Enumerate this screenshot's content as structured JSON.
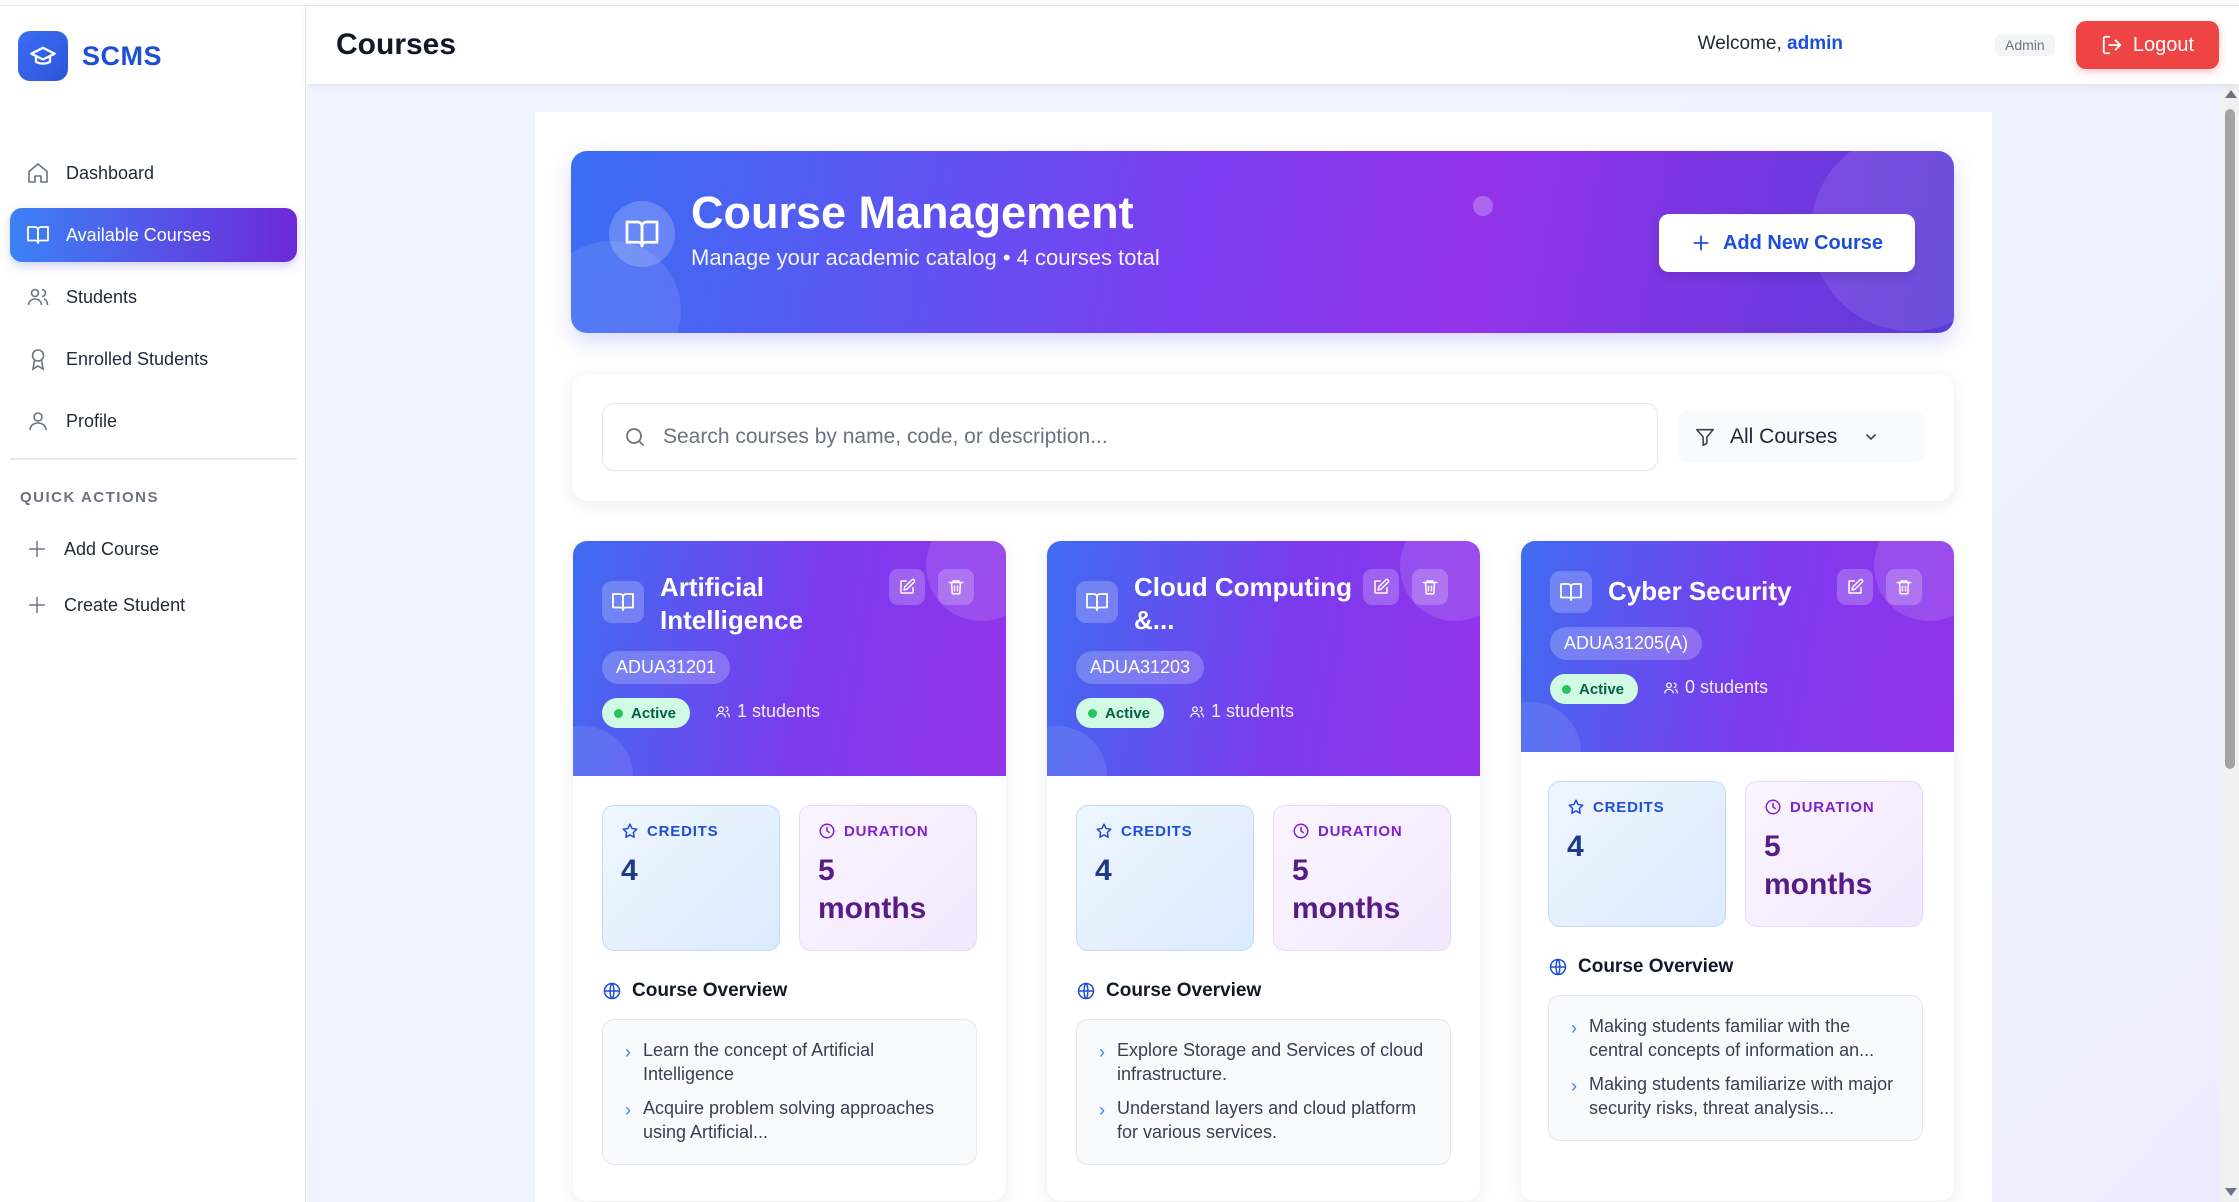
{
  "app": {
    "name": "SCMS"
  },
  "sidebar": {
    "items": [
      {
        "label": "Dashboard",
        "icon": "home-icon"
      },
      {
        "label": "Available Courses",
        "icon": "book-icon",
        "active": true
      },
      {
        "label": "Students",
        "icon": "users-icon"
      },
      {
        "label": "Enrolled Students",
        "icon": "award-icon"
      },
      {
        "label": "Profile",
        "icon": "user-icon"
      }
    ],
    "quick_actions_title": "QUICK ACTIONS",
    "quick_actions": [
      {
        "label": "Add Course",
        "icon": "plus-icon"
      },
      {
        "label": "Create Student",
        "icon": "plus-icon"
      }
    ]
  },
  "header": {
    "title": "Courses",
    "welcome_prefix": "Welcome, ",
    "username": "admin",
    "role": "Admin",
    "logout_label": "Logout"
  },
  "hero": {
    "title": "Course Management",
    "subtitle": "Manage your academic catalog • 4 courses total",
    "add_button_label": "Add New Course"
  },
  "search": {
    "placeholder": "Search courses by name, code, or description...",
    "value": "",
    "filter_label": "All Courses"
  },
  "courses": [
    {
      "title": "Artificial Intelligence",
      "code": "ADUA31201",
      "status": "Active",
      "students": "1 students",
      "credits_label": "CREDITS",
      "credits": "4",
      "duration_label": "DURATION",
      "duration_num": "5",
      "duration_unit": "months",
      "overview_title": "Course Overview",
      "overview": [
        "Learn the concept of Artificial Intelligence",
        "Acquire problem solving approaches using Artificial..."
      ]
    },
    {
      "title": "Cloud Computing &...",
      "code": "ADUA31203",
      "status": "Active",
      "students": "1 students",
      "credits_label": "CREDITS",
      "credits": "4",
      "duration_label": "DURATION",
      "duration_num": "5",
      "duration_unit": "months",
      "overview_title": "Course Overview",
      "overview": [
        "Explore Storage and Services of cloud infrastructure.",
        "Understand layers and cloud platform for various services."
      ]
    },
    {
      "title": "Cyber Security",
      "code": "ADUA31205(A)",
      "status": "Active",
      "students": "0 students",
      "credits_label": "CREDITS",
      "credits": "4",
      "duration_label": "DURATION",
      "duration_num": "5",
      "duration_unit": "months",
      "overview_title": "Course Overview",
      "overview": [
        "Making students familiar with the central concepts of information an...",
        "Making students familiarize with major security risks, threat analysis..."
      ]
    }
  ],
  "colors": {
    "primary": "#1d4ed8",
    "accent_purple": "#9333ea",
    "logout": "#ef4444",
    "active_green": "#22c55e"
  }
}
